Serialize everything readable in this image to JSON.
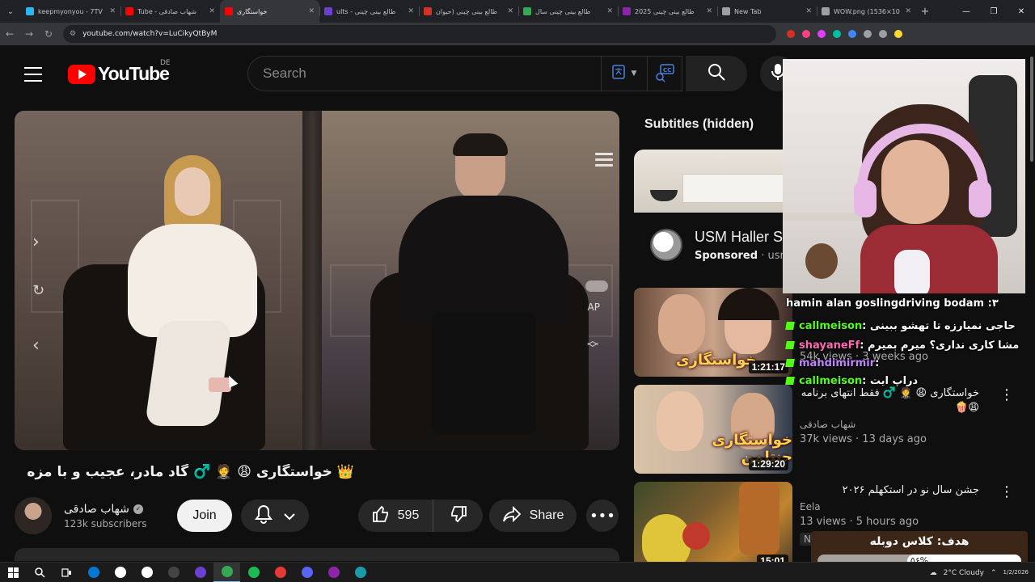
{
  "browser": {
    "tabs": [
      {
        "title": "keepmyonyou - 7TV",
        "favicon_color": "#29b6f6",
        "active": false
      },
      {
        "title": "Tube - شهاب صادقی",
        "favicon_color": "#ff0000",
        "active": false
      },
      {
        "title": "خواستگاری",
        "favicon_color": "#ff0000",
        "active": true
      },
      {
        "title": "ults - طالع بینی چینی",
        "favicon_color": "#6b3fd1",
        "active": false
      },
      {
        "title": "طالع بینی چینی (حیوان",
        "favicon_color": "#d93025",
        "active": false
      },
      {
        "title": "طالع بینی چینی سال",
        "favicon_color": "#34a853",
        "active": false
      },
      {
        "title": "طالع بینی چینی 2025",
        "favicon_color": "#8e24aa",
        "active": false
      },
      {
        "title": "New Tab",
        "favicon_color": "#9aa0a6",
        "active": false
      },
      {
        "title": "WOW.png (1536×10",
        "favicon_color": "#9aa0a6",
        "active": false
      }
    ],
    "url": "youtube.com/watch?v=LuCikyQtByM",
    "extension_icons": [
      "#d93025",
      "#ff4081",
      "#e040fb",
      "#00bfa5",
      "#4285f4",
      "#9aa0a6",
      "#9aa0a6",
      "#fdd835"
    ]
  },
  "header": {
    "logo_text": "YouTube",
    "region_code": "DE",
    "search_placeholder": "Search"
  },
  "player": {
    "ap_label": "AP"
  },
  "video": {
    "title": "👑 خواستگاری 😩 🤵 ♂️ گاد مادر، عجیب و با مزه",
    "channel": "شهاب صادقی",
    "subscribers": "123k subscribers",
    "join_label": "Join",
    "like_count": "595",
    "share_label": "Share"
  },
  "sidebar": {
    "subtitles_label": "Subtitles (hidden)",
    "ad": {
      "title": "USM Haller S",
      "sponsored": "Sponsored",
      "domain": "usm"
    },
    "recommendations": [
      {
        "title": "",
        "channel": "",
        "meta": "54k views · 3 weeks ago",
        "duration": "1:21:17",
        "thumb_tag": "خواستگاری",
        "badge": ""
      },
      {
        "title": "خواستگاری 😩 🤵 ♂️ فقط انتهای برنامه 😩🍿",
        "channel": "شهاب صادقی",
        "meta": "37k views · 13 days ago",
        "duration": "1:29:20",
        "thumb_tag": "خواستگاری جنتلمن",
        "badge": ""
      },
      {
        "title": "جشن سال نو در استکهلم ۲۰۲۶",
        "channel": "Eela",
        "meta": "13 views · 5 hours ago",
        "duration": "15:01",
        "thumb_tag": "",
        "badge": "New"
      }
    ]
  },
  "chat": {
    "messages": [
      {
        "user": "",
        "text": "hamin alan goslingdriving bodam :٣",
        "color": "#ffffff"
      },
      {
        "user": "callmeison",
        "text": "حاجی نمیارزه تا تهشو ببینی",
        "color": "#53fc18"
      },
      {
        "user": "shayaneFf",
        "text": "مشا کاری نداری؟ میرم بمیرم",
        "color": "#ff69b4"
      },
      {
        "user": "mahdimirmir",
        "text": "",
        "color": "#c084fc"
      },
      {
        "user": "callmeison",
        "text": "دراپ ایت",
        "color": "#53fc18"
      }
    ]
  },
  "goal": {
    "title": "هدف: کلاس دوبله",
    "percent_label": "۵۶%",
    "progress": 0.56
  },
  "taskbar": {
    "apps": [
      "#0078d4",
      "#ffffff",
      "#ffffff",
      "#444444",
      "#6b3fd1",
      "#34a853",
      "#1db954",
      "#e53935",
      "#5865f2",
      "#8e24aa",
      "#1b9aaa"
    ],
    "weather": "2°C Cloudy",
    "time": "",
    "date": "1/2/2026"
  }
}
